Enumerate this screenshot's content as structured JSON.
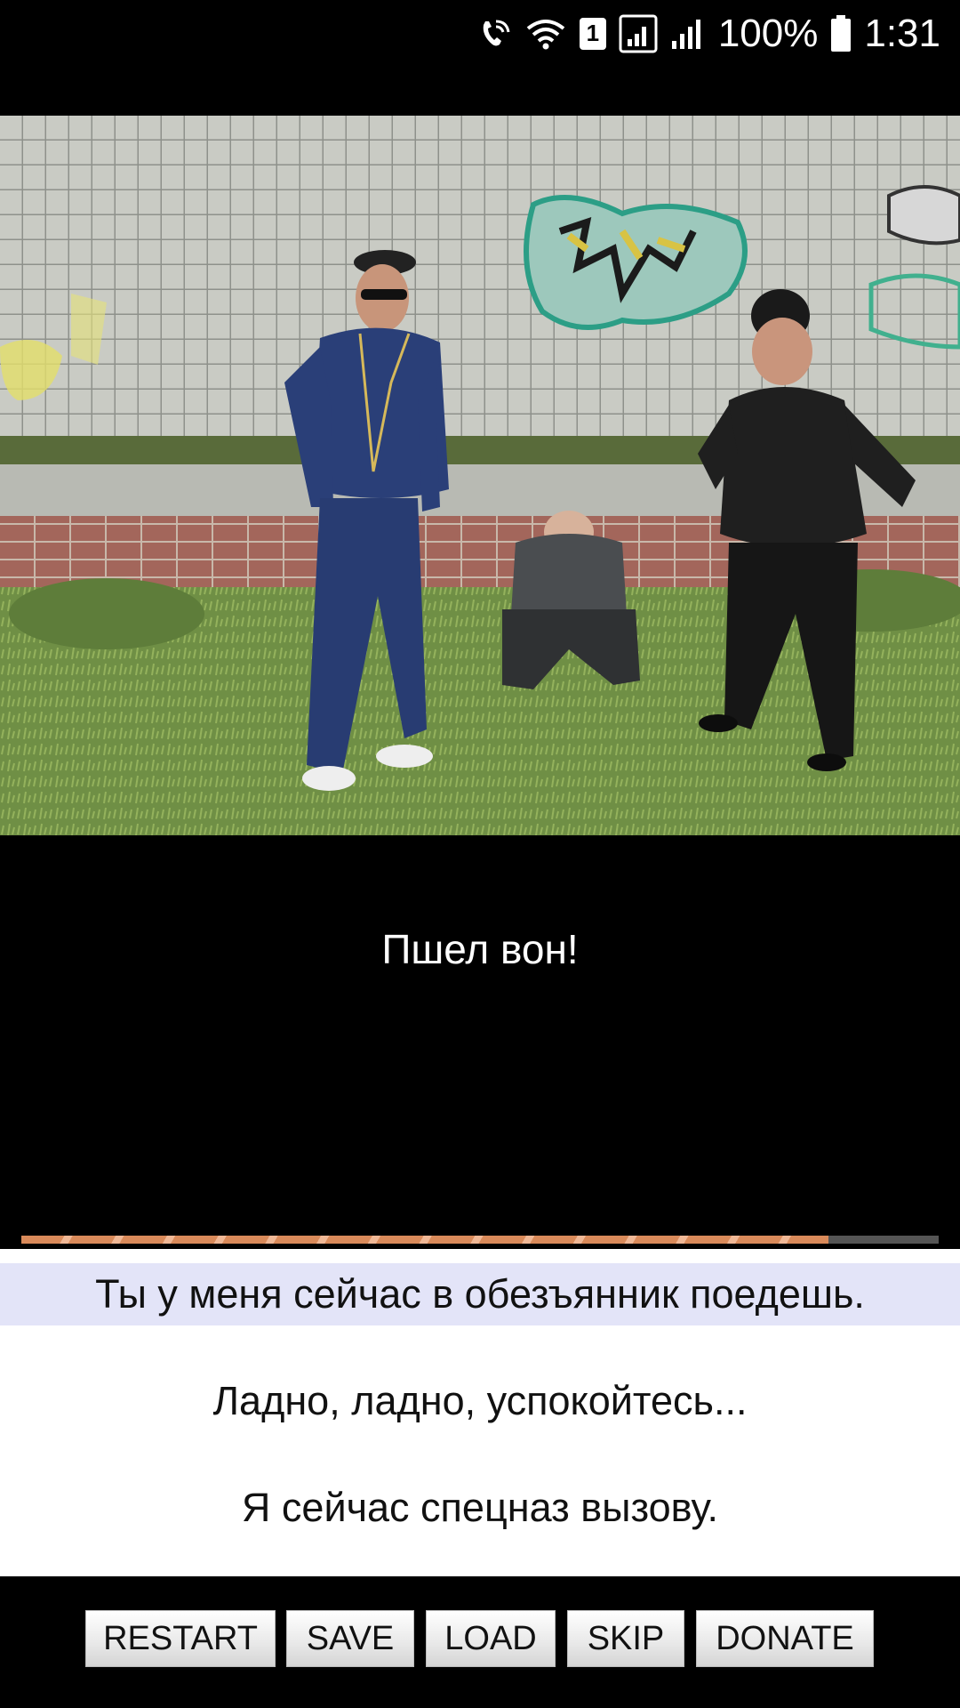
{
  "status_bar": {
    "battery": "100%",
    "time": "1:31",
    "sim_slot": "1",
    "icons": [
      "wifi-call-icon",
      "wifi-icon",
      "sim-badge",
      "signal-icon",
      "signal-icon-2",
      "battery-icon"
    ]
  },
  "scene": {
    "image": "graffiti-wall-three-men-scene"
  },
  "narration": {
    "text": "Пшел вон!"
  },
  "progress": {
    "fraction": 0.88
  },
  "choices": [
    {
      "label": "Ты у меня сейчас в обезъянник поедешь.",
      "selected": true
    },
    {
      "label": "Ладно, ладно, успокойтесь...",
      "selected": false
    },
    {
      "label": "Я сейчас спецназ вызову.",
      "selected": false
    }
  ],
  "buttons": {
    "restart": "RESTART",
    "save": "SAVE",
    "load": "LOAD",
    "skip": "SKIP",
    "donate": "DONATE"
  },
  "colors": {
    "background": "#000000",
    "choice_highlight": "#e3e4f8",
    "progress": "#d98a5a"
  }
}
